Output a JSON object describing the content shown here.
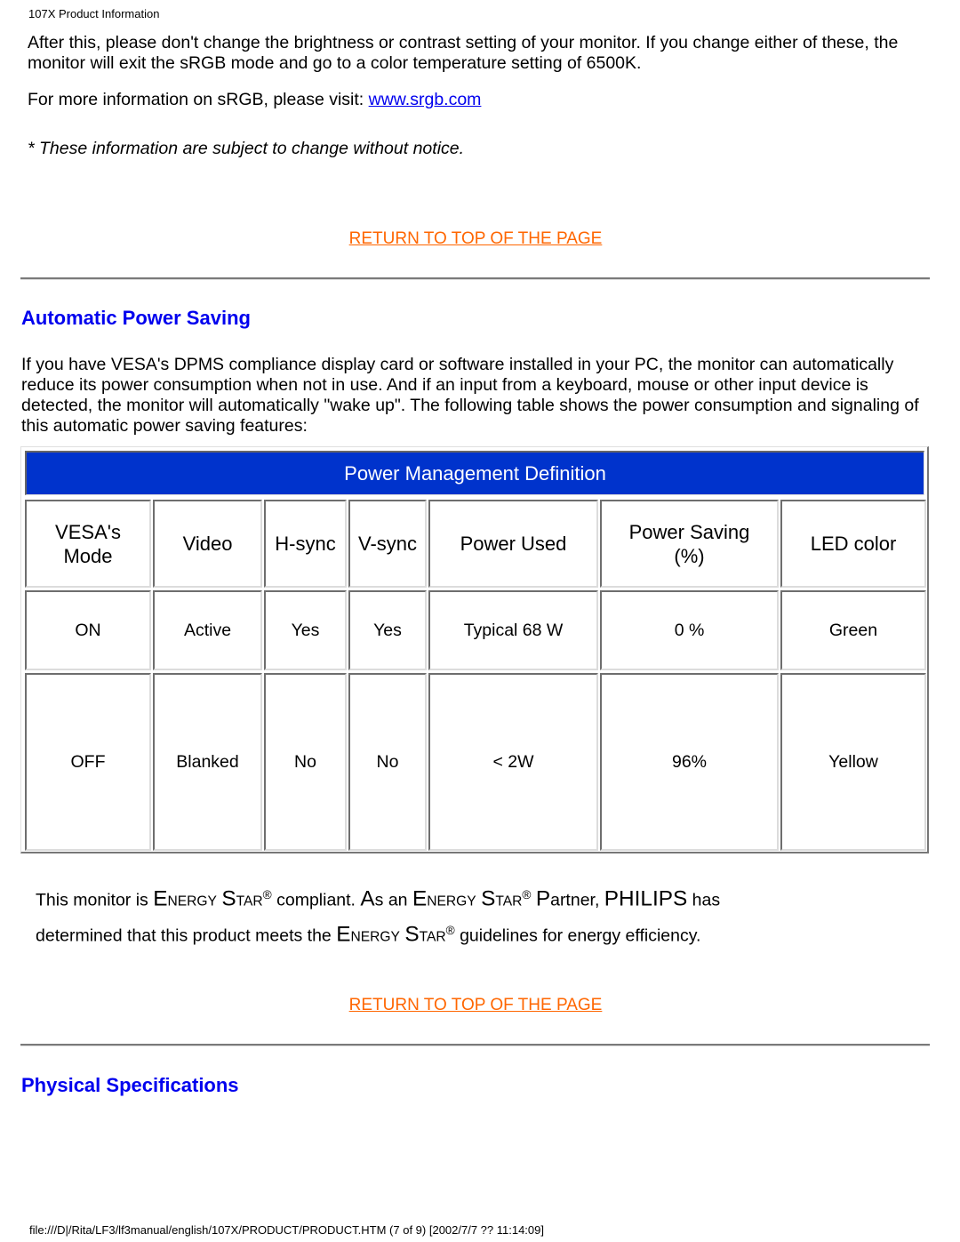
{
  "running_head": "107X Product Information",
  "intro": {
    "paragraph": "After this, please don't change the brightness or contrast setting of your monitor. If you change either of these, the monitor will exit the sRGB mode and go to a color temperature setting of 6500K.",
    "more_info_prefix": "For more information on sRGB, please visit: ",
    "more_info_link": "www.srgb.com",
    "notice": "* These information are subject to change without notice."
  },
  "return_link_label": "RETURN TO TOP OF THE PAGE",
  "automatic_power_saving": {
    "title": "Automatic Power Saving",
    "paragraph": "If you have VESA's DPMS compliance display card or software installed in your PC, the monitor can automatically reduce its power consumption when not in use. And if an input from a keyboard, mouse or other input device is detected, the monitor will automatically \"wake up\". The following table shows the power consumption and signaling of this automatic power saving features:"
  },
  "power_table": {
    "title": "Power Management Definition",
    "header_color": "#0033cc",
    "columns": [
      "VESA's Mode",
      "Video",
      "H-sync",
      "V-sync",
      "Power Used",
      "Power Saving (%)",
      "LED color"
    ],
    "column_lines": [
      [
        "VESA's",
        "Mode"
      ],
      [
        "Video"
      ],
      [
        "H-sync"
      ],
      [
        "V-sync"
      ],
      [
        "Power Used"
      ],
      [
        "Power Saving",
        "(%)"
      ],
      [
        "LED color"
      ]
    ],
    "rows": [
      [
        "ON",
        "Active",
        "Yes",
        "Yes",
        "Typical 68 W",
        "0 %",
        "Green"
      ],
      [
        "OFF",
        "Blanked",
        "No",
        "No",
        "< 2W",
        "96%",
        "Yellow"
      ]
    ]
  },
  "energy_star": {
    "line1": {
      "t1": "This monitor is ",
      "e": "E",
      "nergy": "NERGY",
      "s": "S",
      "tar": "TAR",
      "reg": "®",
      "t2": " compliant. ",
      "a": "A",
      "s_an": "s an ",
      "t3": " ",
      "p": "P",
      "artner": "artner, ",
      "philips": "PHILIPS",
      "t4": " has"
    },
    "line2": {
      "t1": "determined that this product meets the ",
      "t2": " guidelines for energy efficiency."
    }
  },
  "physical_specifications": {
    "title": "Physical Specifications"
  },
  "footer": "file:///D|/Rita/LF3/lf3manual/english/107X/PRODUCT/PRODUCT.HTM (7 of 9) [2002/7/7 ?? 11:14:09]"
}
